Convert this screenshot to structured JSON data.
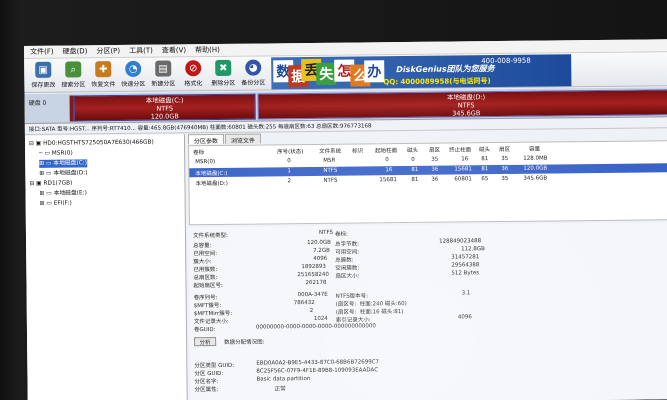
{
  "menu": [
    "文件(F)",
    "硬盘(D)",
    "分区(P)",
    "工具(T)",
    "查看(V)",
    "帮助(H)"
  ],
  "toolbar": [
    {
      "label": "保存更改",
      "icon": "save-icon",
      "color": "#3a6fb0"
    },
    {
      "label": "搜索分区",
      "icon": "search-icon",
      "color": "#4a8f3a"
    },
    {
      "label": "恢复文件",
      "icon": "recover-icon",
      "color": "#c77b1e"
    },
    {
      "label": "快速分区",
      "icon": "quick-partition-icon",
      "color": "#2f7fd0"
    },
    {
      "label": "新建分区",
      "icon": "new-partition-icon",
      "color": "#6a6a6a"
    },
    {
      "label": "格式化",
      "icon": "format-icon",
      "color": "#c01818"
    },
    {
      "label": "删除分区",
      "icon": "delete-partition-icon",
      "color": "#1e9a6a"
    },
    {
      "label": "备份分区",
      "icon": "backup-icon",
      "color": "#3355aa"
    }
  ],
  "banner": {
    "chars": [
      "数",
      "据",
      "丢",
      "失",
      "怎",
      "么",
      "办"
    ],
    "brand": "DiskGenius团队为您服务",
    "phone": "400-008-9958",
    "qq": "QQ: 4000089958(与电话同号)"
  },
  "disk": {
    "label_line1": "硬盘 0",
    "partition_c": {
      "name": "本地磁盘(C:)",
      "fs": "NTFS",
      "size": "120.0GB"
    },
    "partition_d": {
      "name": "本地磁盘(D:)",
      "fs": "NTFS",
      "size": "345.6GB"
    },
    "info": "接口:SATA 型号:HGST... 序列号:RT7410... 容量:465.8GB(476940MB) 柱面数:60801 磁头数:255 每道扇区数:63 总扇区数:976773168"
  },
  "tree": [
    {
      "label": "HD0:HGSTHTS725050A7E630(466GB)",
      "level": 0,
      "selected": false
    },
    {
      "label": "MSR(0)",
      "level": 1,
      "selected": false
    },
    {
      "label": "本地磁盘(C:)",
      "level": 1,
      "selected": true
    },
    {
      "label": "本地磁盘(D:)",
      "level": 1,
      "selected": false
    },
    {
      "label": "RD1(7GB)",
      "level": 0,
      "selected": false
    },
    {
      "label": "本地磁盘(E:)",
      "level": 1,
      "selected": false
    },
    {
      "label": "EFI(F:)",
      "level": 1,
      "selected": false
    }
  ],
  "tabs": [
    "分区参数",
    "浏览文件"
  ],
  "table": {
    "headers": [
      "卷标",
      "序号(状态)",
      "文件系统",
      "标识",
      "起始柱面",
      "磁头",
      "扇区",
      "终止柱面",
      "磁头",
      "扇区",
      "容量"
    ],
    "rows": [
      {
        "cells": [
          "MSR(0)",
          "0",
          "MSR",
          "",
          "0",
          "0",
          "35",
          "16",
          "81",
          "35",
          "128.0MB"
        ],
        "selected": false
      },
      {
        "cells": [
          "本地磁盘(C:)",
          "1",
          "NTFS",
          "",
          "16",
          "81",
          "36",
          "15681",
          "81",
          "36",
          "120.0GB"
        ],
        "selected": true
      },
      {
        "cells": [
          "本地磁盘(D:)",
          "2",
          "NTFS",
          "",
          "15681",
          "81",
          "36",
          "60801",
          "65",
          "35",
          "345.6GB"
        ],
        "selected": false
      }
    ]
  },
  "fsinfo": {
    "left_labels": [
      "文件系统类型:",
      "总容量:",
      "已用空间:",
      "簇大小:",
      "已用簇数:",
      "总扇区数:",
      "起始扇区号:"
    ],
    "left_values": [
      "NTFS",
      "120.0GB",
      "7.2GB",
      "4096",
      "1892893",
      "251658240",
      "262178"
    ],
    "right_labels": [
      "卷标:",
      "总字节数:",
      "可用空间:",
      "总簇数:",
      "空闲簇数:",
      "扇区大小:"
    ],
    "right_values": [
      "",
      "128849023488",
      "112.8GB",
      "31457281",
      "29564388",
      "512 Bytes"
    ],
    "extra_left_labels": [
      "卷序列号:",
      "$MFT簇号:",
      "$MFTMirr簇号:",
      "文件记录大小:",
      "卷GUID:"
    ],
    "extra_left_values": [
      "000A-347E",
      "786432",
      "2",
      "1024",
      "00000000-0000-0000-0000-000000000000"
    ],
    "extra_right_labels": [
      "NTFS版本号:",
      "(扇区号:",
      "(扇区号:",
      "索引记录大小:"
    ],
    "extra_right_values": [
      "3.1",
      "柱面:240 磁头:60)",
      "柱面:16 磁头:81)",
      "4096"
    ],
    "analyze_button": "分析",
    "analyze_label": "数据分配情况图:",
    "guid_labels": [
      "分区类型 GUID:",
      "分区 GUID:",
      "分区名字:",
      "分区属性:"
    ],
    "guid_values": [
      "EBD0A0A2-B9E5-4433-87C0-68B6B72699C7",
      "8C25F56C-07F9-4F1E-89B8-109093EAADAC",
      "Basic data partition",
      "正常"
    ]
  },
  "colors": {
    "partition": "#a52020",
    "selected": "#3366cc",
    "banner": "#1d4a9b"
  }
}
